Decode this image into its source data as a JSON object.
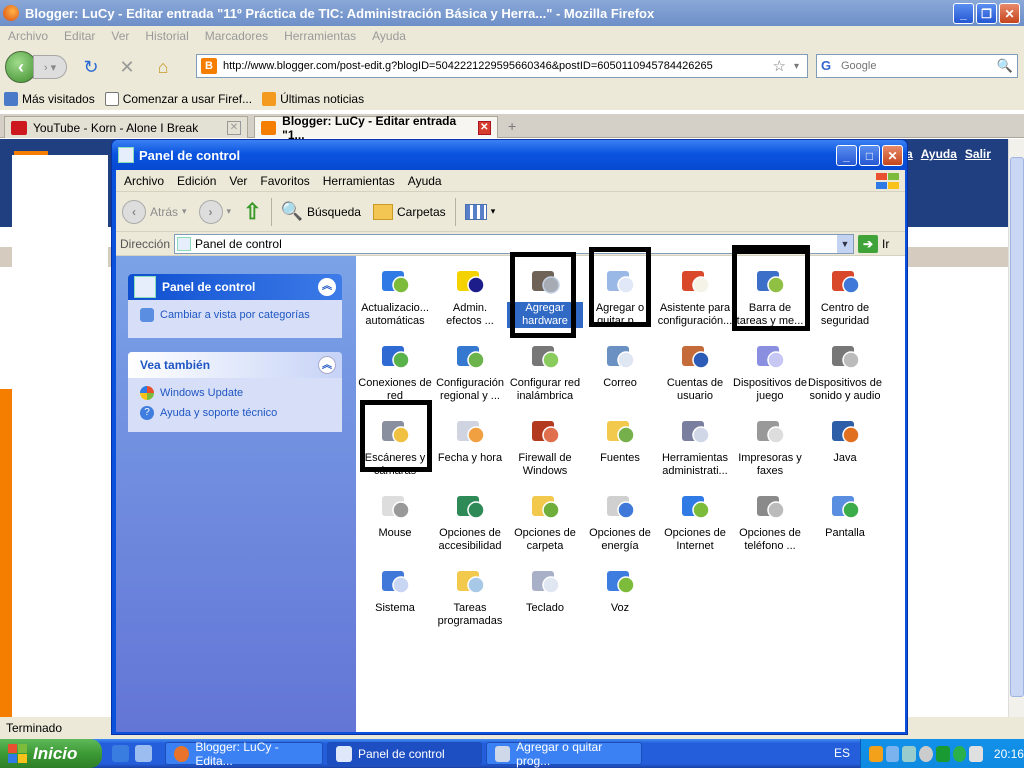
{
  "firefox": {
    "title": "Blogger: LuCy - Editar entrada \"11º Práctica de TIC: Administración Básica y Herra...\" - Mozilla Firefox",
    "menu": [
      "Archivo",
      "Editar",
      "Ver",
      "Historial",
      "Marcadores",
      "Herramientas",
      "Ayuda"
    ],
    "url": "http://www.blogger.com/post-edit.g?blogID=5042221229595660346&postID=6050110945784426265",
    "search_placeholder": "Google",
    "bookmarks": [
      "Más visitados",
      "Comenzar a usar Firef...",
      "Últimas noticias"
    ],
    "tabs": [
      {
        "label": "YouTube - Korn - Alone I Break"
      },
      {
        "label": "Blogger: LuCy - Editar entrada \"1..."
      }
    ],
    "blog_links": [
      "a",
      "Ayuda",
      "Salir"
    ],
    "status": "Terminado"
  },
  "control_panel": {
    "title": "Panel de control",
    "menu": [
      "Archivo",
      "Edición",
      "Ver",
      "Favoritos",
      "Herramientas",
      "Ayuda"
    ],
    "toolbar": {
      "back": "Atrás",
      "search": "Búsqueda",
      "folders": "Carpetas"
    },
    "address_label": "Dirección",
    "address_value": "Panel de control",
    "go_label": "Ir",
    "left": {
      "panel1_title": "Panel de control",
      "panel1_link": "Cambiar a vista por categorías",
      "panel2_title": "Vea también",
      "panel2_links": [
        "Windows Update",
        "Ayuda y soporte técnico"
      ]
    },
    "items": [
      "Actualizacio...\nautomáticas",
      "Admin.\nefectos ...",
      "Agregar\nhardware",
      "Agregar o\nquitar p...",
      "Asistente para\nconfiguración...",
      "Barra de\ntareas y me...",
      "Centro de\nseguridad",
      "Conexiones de\nred",
      "Configuración\nregional y ...",
      "Configurar red\ninalámbrica",
      "Correo",
      "Cuentas de\nusuario",
      "Dispositivos de\njuego",
      "Dispositivos de\nsonido y audio",
      "Escáneres y\ncámaras",
      "Fecha y hora",
      "Firewall de\nWindows",
      "Fuentes",
      "Herramientas\nadministrati...",
      "Impresoras y\nfaxes",
      "Java",
      "Mouse",
      "Opciones de\naccesibilidad",
      "Opciones de\ncarpeta",
      "Opciones de\nenergía",
      "Opciones de\nInternet",
      "Opciones de\nteléfono ...",
      "Pantalla",
      "Sistema",
      "Tareas\nprogramadas",
      "Teclado",
      "Voz"
    ]
  },
  "taskbar": {
    "start": "Inicio",
    "tasks": [
      "Blogger: LuCy - Edita...",
      "Panel de control",
      "Agregar o quitar prog..."
    ],
    "lang": "ES",
    "clock": "20:16"
  }
}
